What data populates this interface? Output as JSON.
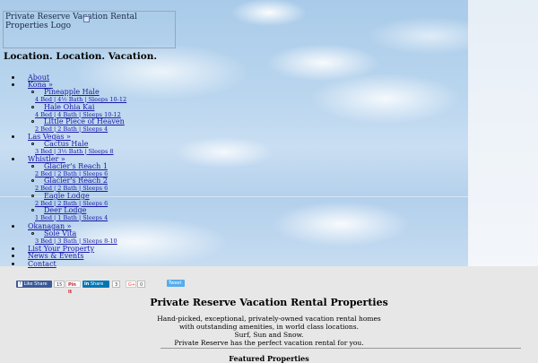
{
  "logo": {
    "alt": "Private Reserve Vacation Rental Properties Logo"
  },
  "tagline": "Location. Location. Vacation.",
  "nav": {
    "about": "About",
    "kona": "Kona »",
    "kona_items": [
      {
        "name": "Pineapple Hale",
        "detail": "4 Bed | 4½ Bath | Sleeps 10-12"
      },
      {
        "name": "Hale Ohia Kai",
        "detail": "4 Bed | 4 Bath | Sleeps 10-12"
      },
      {
        "name": "Little Piece of Heaven",
        "detail": "2 Bed | 2 Bath | Sleeps 4"
      }
    ],
    "vegas": "Las Vegas »",
    "vegas_items": [
      {
        "name": "Cactus Hale",
        "detail": "3 Bed | 3½ Bath | Sleeps 8"
      }
    ],
    "whistler": "Whistler »",
    "whistler_items": [
      {
        "name": "Glacier's Reach 1",
        "detail": "2 Bed | 2 Bath | Sleeps 6"
      },
      {
        "name": "Glacier's Reach 2",
        "detail": "2 Bed | 2 Bath | Sleeps 6"
      },
      {
        "name": "Eagle Lodge",
        "detail": "2 Bed | 2 Bath | Sleeps 6"
      },
      {
        "name": "Deer Lodge",
        "detail": "1 Bed | 1 Bath | Sleeps 4"
      }
    ],
    "okanagan": "Okanagan »",
    "okanagan_items": [
      {
        "name": "Sole Vita",
        "detail": "3 Bed | 3 Bath | Sleeps 8-10"
      }
    ],
    "list": "List Your Property",
    "news": "News & Events",
    "contact": "Contact"
  },
  "social": {
    "fb_label": "Like",
    "fb_share": "Share",
    "fb_count": "15",
    "pin_label": "Pin it",
    "in_label": "Share",
    "in_count": "3",
    "gplus_label": "G+",
    "gplus_count": "0",
    "tweet_label": "Tweet"
  },
  "main": {
    "title": "Private Reserve Vacation Rental Properties",
    "desc1": "Hand-picked, exceptional, privately-owned vacation rental homes",
    "desc2": "with outstanding amenities, in world class locations.",
    "desc3": "Surf, Sun and Snow.",
    "desc4": "Private Reserve has the perfect vacation rental for you.",
    "section_heading": "Featured Properties"
  },
  "colors": {
    "link": "#1a1aa6",
    "facebook": "#3b5998",
    "pinterest": "#cb2027",
    "linkedin": "#0077b5",
    "twitter": "#55acee"
  }
}
